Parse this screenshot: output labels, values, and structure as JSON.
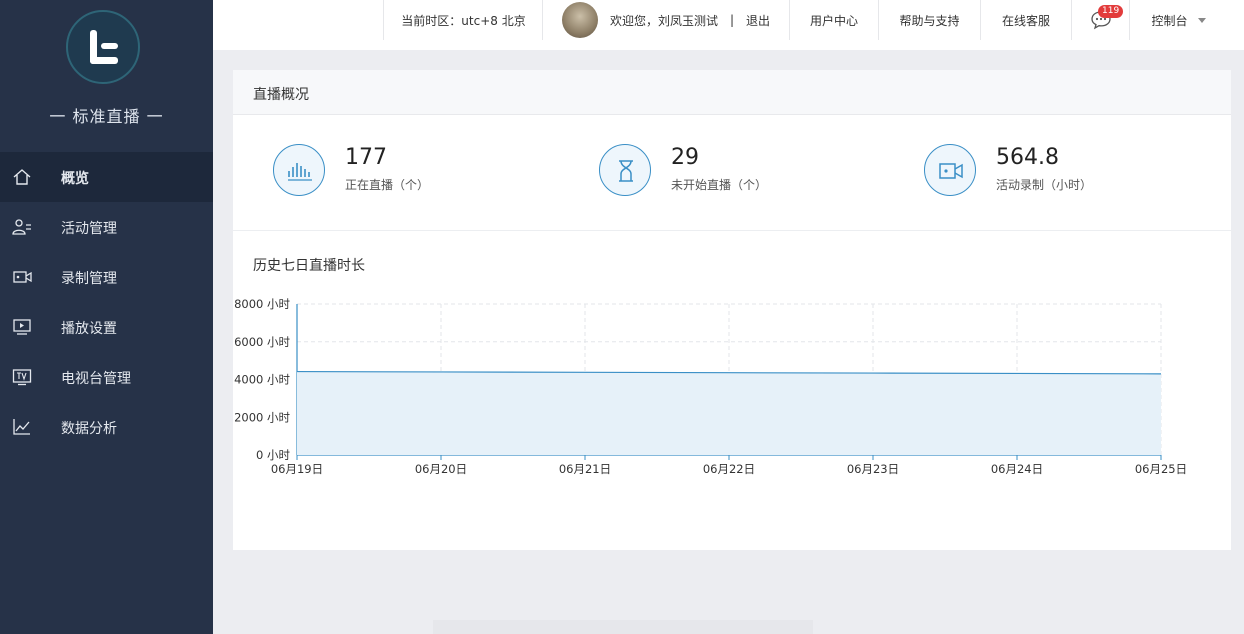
{
  "sidebar": {
    "brand": "一 标准直播 一",
    "items": [
      {
        "label": "概览",
        "icon": "home-icon",
        "active": true
      },
      {
        "label": "活动管理",
        "icon": "users-icon"
      },
      {
        "label": "录制管理",
        "icon": "video-camera-icon"
      },
      {
        "label": "播放设置",
        "icon": "play-screen-icon"
      },
      {
        "label": "电视台管理",
        "icon": "tv-icon"
      },
      {
        "label": "数据分析",
        "icon": "line-chart-icon"
      }
    ]
  },
  "topbar": {
    "timezone": "当前时区：utc+8 北京",
    "welcome": "欢迎您，刘凤玉测试",
    "separator": "|",
    "logout": "退出",
    "user_center": "用户中心",
    "help": "帮助与支持",
    "online_service": "在线客服",
    "message_badge": "119",
    "console": "控制台"
  },
  "overview": {
    "title": "直播概况",
    "stats": [
      {
        "value": "177",
        "label": "正在直播（个）",
        "icon": "bar-signal-icon"
      },
      {
        "value": "29",
        "label": "未开始直播（个）",
        "icon": "hourglass-icon"
      },
      {
        "value": "564.8",
        "label": "活动录制（小时）",
        "icon": "video-camera-icon"
      }
    ]
  },
  "chart_title": "历史七日直播时长",
  "chart_data": {
    "type": "area",
    "title": "历史七日直播时长",
    "categories": [
      "06月19日",
      "06月20日",
      "06月21日",
      "06月22日",
      "06月23日",
      "06月24日",
      "06月25日"
    ],
    "series": [
      {
        "values": [
          4420,
          4400,
          4380,
          4360,
          4340,
          4320,
          4300
        ]
      }
    ],
    "y_ticks": [
      "0 小时",
      "2000 小时",
      "4000 小时",
      "6000 小时",
      "8000 小时"
    ],
    "ylim": [
      0,
      8000
    ],
    "grid": true,
    "colors": {
      "line": "#3a8fc6",
      "fill": "#e6f1f9",
      "grid": "#e3e6ea"
    }
  }
}
